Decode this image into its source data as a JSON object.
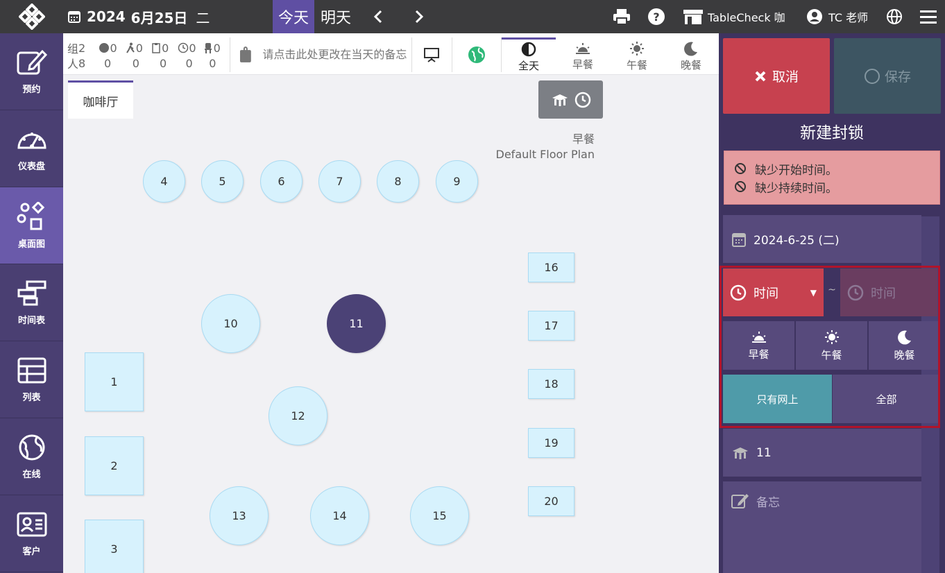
{
  "topbar": {
    "year": "2024",
    "date": "6月25日",
    "weekday": "二",
    "today": "今天",
    "tomorrow": "明天",
    "prev": "‹",
    "next": "›",
    "store": "TableCheck 咖",
    "user": "TC 老师"
  },
  "sidebar": {
    "items": [
      {
        "label": "预约"
      },
      {
        "label": "仪表盘"
      },
      {
        "label": "桌面图"
      },
      {
        "label": "时间表"
      },
      {
        "label": "列表"
      },
      {
        "label": "在线"
      },
      {
        "label": "客户"
      }
    ]
  },
  "stats": {
    "row1_label": "组",
    "row2_label": "人",
    "group_values": [
      "2",
      "0",
      "0",
      "0",
      "0",
      "0"
    ],
    "people_values": [
      "8",
      "0",
      "0",
      "0",
      "0",
      "0"
    ]
  },
  "toolbar": {
    "memo_placeholder": "请点击此处更改在当天的备忘",
    "meal_tabs": [
      "全天",
      "早餐",
      "午餐",
      "晚餐"
    ]
  },
  "floor": {
    "tab": "咖啡厅",
    "meal": "早餐",
    "plan": "Default Floor Plan",
    "tables": [
      "1",
      "2",
      "3",
      "4",
      "5",
      "6",
      "7",
      "8",
      "9",
      "10",
      "11",
      "12",
      "13",
      "14",
      "15",
      "16",
      "17",
      "18",
      "19",
      "20"
    ],
    "selected_table": "11"
  },
  "panel": {
    "cancel": "取消",
    "save": "保存",
    "title": "新建封锁",
    "errors": [
      "缺少开始时间。",
      "缺少持续时间。"
    ],
    "date": "2024-6-25 (二)",
    "start_time_placeholder": "时间",
    "end_time_placeholder": "时间",
    "tilde": "~",
    "meals": [
      "早餐",
      "午餐",
      "晚餐"
    ],
    "options": [
      "只有网上",
      "全部"
    ],
    "table": "11",
    "memo_placeholder": "备忘"
  },
  "colors": {
    "sidebar": "#4a3f72",
    "sidebar_active": "#6a5aaa",
    "accent": "#5f4fa3",
    "cancel": "#c7414f",
    "table_fill": "#d7f2fd",
    "selected_table": "#4b4276",
    "online_only": "#4f9ba9"
  }
}
